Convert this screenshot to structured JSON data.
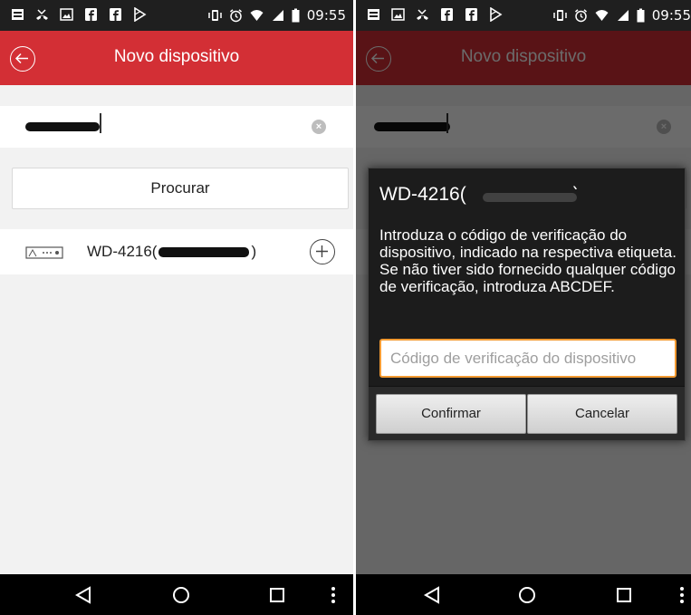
{
  "status_bar": {
    "time": "09:55"
  },
  "app_bar": {
    "title": "Novo dispositivo",
    "back_icon": "circle-back-arrow-icon"
  },
  "search": {
    "value_redacted": true,
    "clear_icon": "clear-circle-icon"
  },
  "search_button": {
    "label": "Procurar"
  },
  "result": {
    "device_name_prefix": "WD-4216(",
    "device_name_suffix": ")",
    "device_icon": "dvr-device-icon",
    "add_icon": "circle-plus-icon"
  },
  "dialog": {
    "title_prefix": "WD-4216(",
    "title_suffix": ")",
    "message": "Introduza o código de verificação do dispositivo, indicado na respectiva etiqueta. Se não tiver sido fornecido qualquer código de verificação, introduza ABCDEF.",
    "input_placeholder": "Código de verificação do dispositivo",
    "confirm_label": "Confirmar",
    "cancel_label": "Cancelar"
  },
  "nav_bar": {
    "back_icon": "nav-back-icon",
    "home_icon": "nav-home-icon",
    "recents_icon": "nav-recents-icon",
    "menu_icon": "nav-menu-icon"
  },
  "colors": {
    "accent": "#d32f35",
    "dialog_bg": "#1c1c1c",
    "input_border": "#f39b33"
  }
}
